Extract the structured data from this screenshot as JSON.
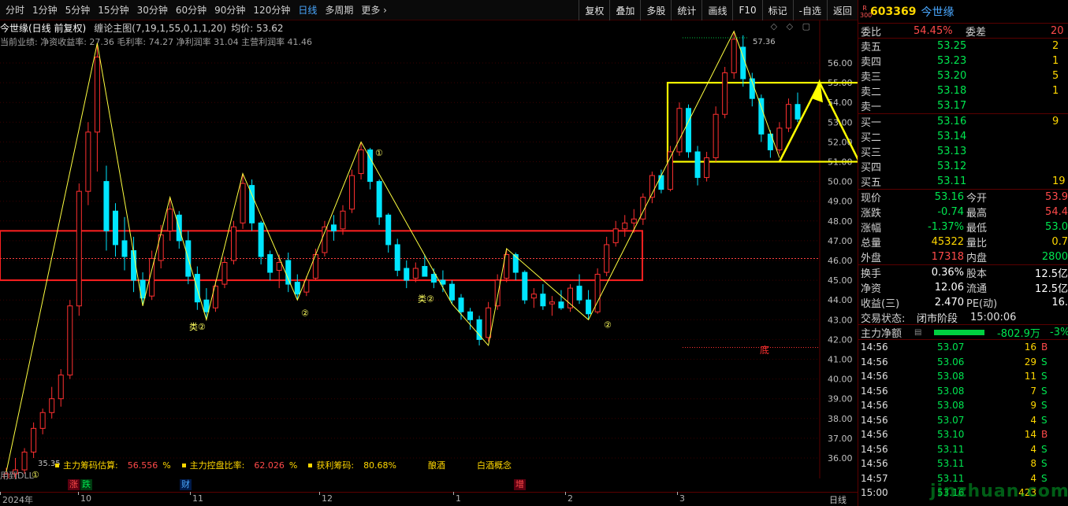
{
  "periods": [
    "分时",
    "1分钟",
    "5分钟",
    "15分钟",
    "30分钟",
    "60分钟",
    "90分钟",
    "120分钟",
    "日线",
    "多周期",
    "更多 ›"
  ],
  "active_period": "日线",
  "toolbar": [
    "复权",
    "叠加",
    "多股",
    "统计",
    "画线",
    "F10",
    "标记",
    "-自选",
    "返回"
  ],
  "chart_header": {
    "stock_label": "今世缘(日线 前复权)",
    "indicator_label": "缠论主图(7,19,1,55,0,1,1,20)",
    "avg_label": "均价: 53.62",
    "perf_line": "当前业绩: 净资收益率: 27.36 毛利率: 74.27 净利润率 31.04 主营利润率 41.46"
  },
  "price_axis": [
    "56.00",
    "55.00",
    "54.00",
    "53.00",
    "52.00",
    "51.00",
    "50.00",
    "49.00",
    "48.00",
    "47.00",
    "46.00",
    "45.00",
    "44.00",
    "43.00",
    "42.00",
    "41.00",
    "40.00",
    "39.00",
    "38.00",
    "37.00",
    "36.00"
  ],
  "annotations": {
    "high_label": "57.36",
    "low_label": "35.35",
    "bottom_label": "底",
    "wave_labels": [
      "①",
      "①",
      "②",
      "②",
      "②",
      "类②",
      "类②"
    ]
  },
  "bottom_stats": [
    {
      "label": "主力筹码估算:",
      "value": "56.556",
      "unit": "%"
    },
    {
      "label": "主力控盘比率:",
      "value": "62.026",
      "unit": "%"
    },
    {
      "label": "获利筹码:",
      "value": "80.68%",
      "unit": ""
    },
    {
      "label": "酿酒",
      "value": "",
      "unit": ""
    },
    {
      "label": "白酒概念",
      "value": "",
      "unit": ""
    }
  ],
  "used_label": "用到DLL",
  "events": [
    {
      "text": "涨",
      "color": "#ff4a4a",
      "bg": "#5a0010"
    },
    {
      "text": "跌",
      "color": "#00e650",
      "bg": "#003a10"
    },
    {
      "text": "财",
      "color": "#4aa8ff",
      "bg": "#001a4a"
    },
    {
      "text": "增",
      "color": "#ff4a4a",
      "bg": "#5a0010"
    }
  ],
  "dates": [
    "2024年",
    "10",
    "11",
    "12",
    "1",
    "2",
    "3"
  ],
  "period_tab_bottom": "日线",
  "quote": {
    "r_badge": "R 300",
    "code": "603369",
    "name": "今世缘",
    "wei_bi_label": "委比",
    "wei_bi": "54.45%",
    "wei_cha_label": "委差",
    "wei_cha": "20",
    "asks": [
      {
        "label": "卖五",
        "price": "53.25",
        "vol": "2"
      },
      {
        "label": "卖四",
        "price": "53.23",
        "vol": "1"
      },
      {
        "label": "卖三",
        "price": "53.20",
        "vol": "5"
      },
      {
        "label": "卖二",
        "price": "53.18",
        "vol": "1"
      },
      {
        "label": "卖一",
        "price": "53.17",
        "vol": ""
      }
    ],
    "bids": [
      {
        "label": "买一",
        "price": "53.16",
        "vol": "9"
      },
      {
        "label": "买二",
        "price": "53.14",
        "vol": ""
      },
      {
        "label": "买三",
        "price": "53.13",
        "vol": ""
      },
      {
        "label": "买四",
        "price": "53.12",
        "vol": ""
      },
      {
        "label": "买五",
        "price": "53.11",
        "vol": "19"
      }
    ],
    "stats1": [
      {
        "l1": "现价",
        "v1": "53.16",
        "l2": "今开",
        "v2": "53.9"
      },
      {
        "l1": "涨跌",
        "v1": "-0.74",
        "l2": "最高",
        "v2": "54.4"
      },
      {
        "l1": "涨幅",
        "v1": "-1.37%",
        "l2": "最低",
        "v2": "53.0"
      },
      {
        "l1": "总量",
        "v1": "45322",
        "l2": "量比",
        "v2": "0.7"
      },
      {
        "l1": "外盘",
        "v1": "17318",
        "l2": "内盘",
        "v2": "2800"
      }
    ],
    "stats2": [
      {
        "l1": "换手",
        "v1": "0.36%",
        "l2": "股本",
        "v2": "12.5亿"
      },
      {
        "l1": "净资",
        "v1": "12.06",
        "l2": "流通",
        "v2": "12.5亿"
      },
      {
        "l1": "收益(三)",
        "v1": "2.470",
        "l2": "PE(动)",
        "v2": "16."
      }
    ],
    "trade_state_label": "交易状态:",
    "trade_state": "闭市阶段",
    "trade_time": "15:00:06",
    "main_net_label": "主力净额",
    "main_net": "-802.9万",
    "main_net_pct": "-3%"
  },
  "ticks": [
    {
      "t": "14:56",
      "p": "53.07",
      "v": "16",
      "s": "B"
    },
    {
      "t": "14:56",
      "p": "53.06",
      "v": "29",
      "s": "S"
    },
    {
      "t": "14:56",
      "p": "53.08",
      "v": "11",
      "s": "S"
    },
    {
      "t": "14:56",
      "p": "53.08",
      "v": "7",
      "s": "S"
    },
    {
      "t": "14:56",
      "p": "53.08",
      "v": "9",
      "s": "S"
    },
    {
      "t": "14:56",
      "p": "53.07",
      "v": "4",
      "s": "S"
    },
    {
      "t": "14:56",
      "p": "53.10",
      "v": "14",
      "s": "B"
    },
    {
      "t": "14:56",
      "p": "53.11",
      "v": "4",
      "s": "S"
    },
    {
      "t": "14:56",
      "p": "53.11",
      "v": "8",
      "s": "S"
    },
    {
      "t": "14:57",
      "p": "53.11",
      "v": "4",
      "s": "S"
    },
    {
      "t": "15:00",
      "p": "53.16",
      "v": "423",
      "s": ""
    }
  ],
  "watermark": "jinzhuan.com",
  "colors": {
    "up": "#ff3030",
    "down": "#00e5ff",
    "zigzag": "#ffff40",
    "box_red": "#ff2020",
    "box_yellow": "#ffff00"
  },
  "chart_data": {
    "type": "candlestick",
    "ylim": [
      35.0,
      57.8
    ],
    "candles": [
      [
        34.5,
        35.5,
        33.8,
        35.2
      ],
      [
        35.2,
        36.0,
        34.9,
        35.4
      ],
      [
        35.4,
        36.5,
        35.2,
        36.3
      ],
      [
        36.3,
        37.8,
        36.0,
        37.5
      ],
      [
        37.5,
        38.5,
        37.2,
        38.3
      ],
      [
        38.3,
        39.6,
        38.0,
        39.0
      ],
      [
        39.0,
        40.5,
        38.6,
        40.2
      ],
      [
        40.2,
        44.0,
        40.0,
        43.7
      ],
      [
        43.7,
        49.9,
        43.2,
        49.5
      ],
      [
        49.5,
        53.0,
        48.8,
        52.5
      ],
      [
        52.5,
        57.0,
        50.5,
        56.3
      ],
      [
        50.0,
        50.8,
        46.5,
        47.5
      ],
      [
        48.5,
        48.9,
        46.2,
        46.8
      ],
      [
        47.0,
        48.2,
        45.5,
        46.2
      ],
      [
        46.5,
        47.2,
        44.4,
        45.0
      ],
      [
        45.0,
        45.4,
        43.7,
        44.1
      ],
      [
        44.2,
        46.5,
        44.0,
        46.1
      ],
      [
        46.0,
        47.8,
        45.6,
        47.3
      ],
      [
        47.5,
        49.2,
        47.0,
        48.6
      ],
      [
        48.3,
        48.5,
        46.6,
        47.0
      ],
      [
        47.0,
        47.5,
        44.8,
        45.2
      ],
      [
        45.3,
        45.7,
        43.5,
        43.9
      ],
      [
        44.0,
        44.6,
        43.0,
        43.4
      ],
      [
        43.6,
        45.0,
        43.4,
        44.7
      ],
      [
        44.8,
        46.2,
        44.6,
        45.9
      ],
      [
        46.0,
        48.0,
        45.8,
        47.7
      ],
      [
        47.9,
        50.4,
        47.6,
        49.9
      ],
      [
        49.8,
        50.1,
        47.5,
        47.9
      ],
      [
        47.9,
        48.0,
        45.8,
        46.2
      ],
      [
        46.3,
        46.5,
        45.0,
        45.4
      ],
      [
        45.5,
        46.3,
        44.6,
        45.9
      ],
      [
        46.0,
        46.4,
        44.4,
        44.8
      ],
      [
        44.9,
        45.3,
        44.0,
        44.3
      ],
      [
        44.4,
        45.2,
        44.2,
        45.0
      ],
      [
        45.1,
        46.6,
        45.0,
        46.3
      ],
      [
        46.4,
        48.0,
        46.2,
        47.7
      ],
      [
        47.8,
        48.3,
        47.0,
        47.5
      ],
      [
        47.6,
        48.8,
        47.3,
        48.5
      ],
      [
        48.6,
        50.6,
        48.4,
        50.3
      ],
      [
        50.4,
        52.0,
        50.1,
        51.6
      ],
      [
        51.6,
        51.7,
        49.6,
        50.0
      ],
      [
        50.0,
        50.1,
        47.8,
        48.2
      ],
      [
        48.3,
        48.4,
        46.4,
        46.8
      ],
      [
        46.8,
        47.1,
        45.2,
        45.5
      ],
      [
        45.6,
        46.0,
        44.6,
        45.0
      ],
      [
        45.1,
        45.9,
        44.9,
        45.6
      ],
      [
        45.7,
        46.3,
        45.2,
        45.2
      ],
      [
        45.3,
        45.6,
        44.6,
        44.9
      ],
      [
        45.0,
        45.5,
        44.4,
        44.8
      ],
      [
        44.8,
        45.0,
        43.8,
        44.0
      ],
      [
        44.1,
        44.3,
        43.0,
        43.4
      ],
      [
        43.4,
        43.6,
        42.5,
        43.0
      ],
      [
        43.0,
        43.2,
        41.7,
        42.0
      ],
      [
        42.1,
        43.9,
        41.9,
        43.6
      ],
      [
        43.7,
        45.3,
        43.5,
        45.0
      ],
      [
        45.1,
        46.6,
        44.9,
        46.3
      ],
      [
        46.3,
        46.4,
        45.0,
        45.4
      ],
      [
        45.4,
        45.5,
        43.8,
        44.0
      ],
      [
        44.1,
        44.6,
        43.6,
        44.3
      ],
      [
        44.3,
        44.8,
        43.5,
        43.7
      ],
      [
        43.8,
        44.2,
        43.2,
        43.9
      ],
      [
        43.9,
        44.5,
        43.5,
        43.6
      ],
      [
        43.6,
        44.8,
        43.4,
        44.6
      ],
      [
        44.7,
        45.3,
        43.8,
        44.0
      ],
      [
        44.0,
        44.5,
        43.0,
        43.3
      ],
      [
        43.4,
        45.6,
        43.3,
        45.3
      ],
      [
        45.4,
        47.2,
        45.2,
        46.8
      ],
      [
        46.9,
        48.0,
        46.7,
        47.6
      ],
      [
        47.6,
        48.3,
        47.2,
        47.9
      ],
      [
        47.9,
        48.6,
        47.4,
        48.1
      ],
      [
        48.1,
        49.4,
        47.8,
        49.2
      ],
      [
        49.2,
        50.5,
        48.9,
        50.3
      ],
      [
        50.3,
        50.6,
        49.4,
        49.6
      ],
      [
        49.6,
        51.8,
        49.5,
        51.5
      ],
      [
        51.5,
        54.0,
        51.3,
        53.7
      ],
      [
        53.7,
        53.9,
        51.2,
        51.5
      ],
      [
        51.5,
        51.8,
        49.8,
        50.2
      ],
      [
        50.2,
        51.5,
        50.0,
        51.2
      ],
      [
        51.2,
        53.8,
        51.0,
        53.4
      ],
      [
        53.4,
        55.8,
        53.2,
        55.5
      ],
      [
        55.5,
        57.6,
        55.2,
        57.2
      ],
      [
        56.8,
        57.4,
        54.8,
        55.2
      ],
      [
        55.2,
        55.5,
        53.8,
        54.2
      ],
      [
        54.2,
        54.4,
        52.0,
        52.4
      ],
      [
        52.4,
        52.6,
        51.2,
        51.6
      ],
      [
        51.6,
        53.0,
        51.4,
        52.7
      ],
      [
        52.7,
        54.2,
        52.5,
        53.9
      ],
      [
        53.9,
        54.5,
        53.0,
        53.16
      ]
    ]
  }
}
